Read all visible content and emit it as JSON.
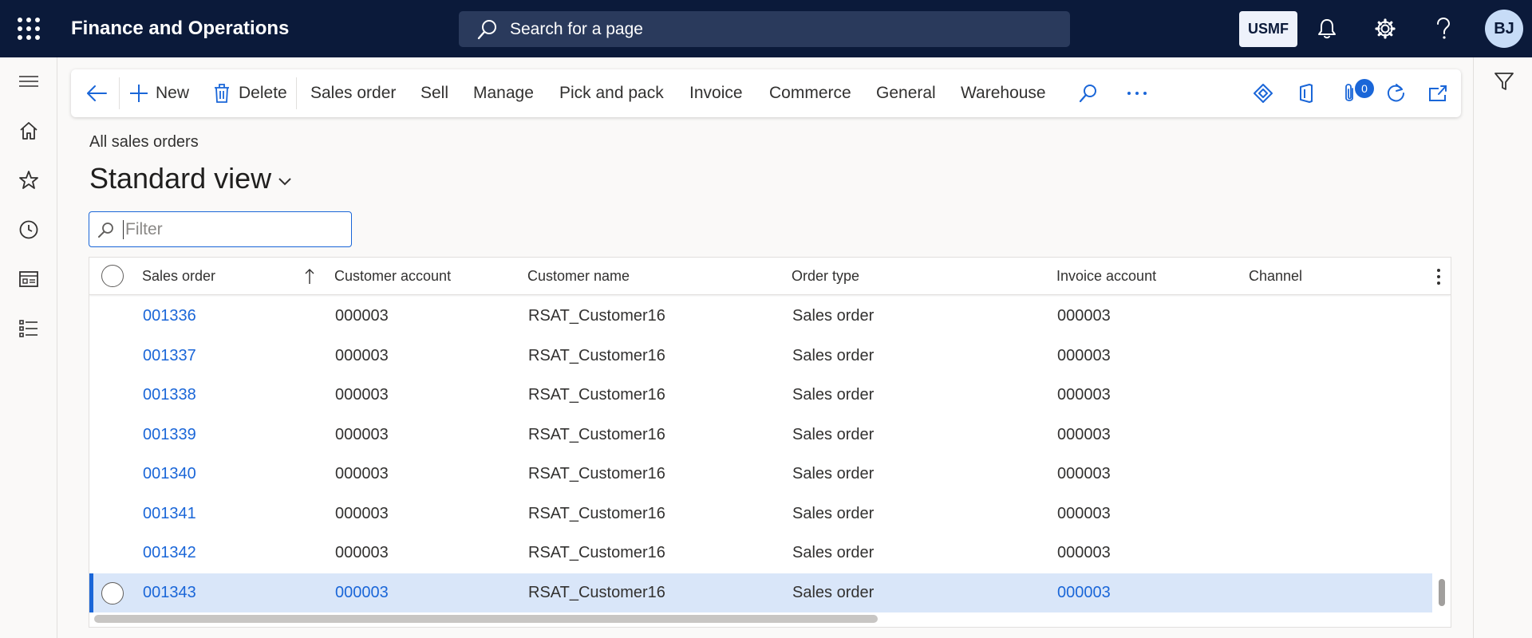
{
  "app": {
    "title": "Finance and Operations"
  },
  "search": {
    "placeholder": "Search for a page"
  },
  "header": {
    "company": "USMF",
    "avatar_initials": "BJ"
  },
  "action_pane": {
    "new_label": "New",
    "delete_label": "Delete",
    "tabs": [
      "Sales order",
      "Sell",
      "Manage",
      "Pick and pack",
      "Invoice",
      "Commerce",
      "General",
      "Warehouse"
    ],
    "attachments_count": "0"
  },
  "page": {
    "breadcrumb": "All sales orders",
    "view_title": "Standard view"
  },
  "filter": {
    "placeholder": "Filter"
  },
  "grid": {
    "columns": [
      "Sales order",
      "Customer account",
      "Customer name",
      "Order type",
      "Invoice account",
      "Channel"
    ],
    "rows": [
      {
        "sales_order": "001336",
        "customer_account": "000003",
        "customer_name": "RSAT_Customer16",
        "order_type": "Sales order",
        "invoice_account": "000003",
        "channel": ""
      },
      {
        "sales_order": "001337",
        "customer_account": "000003",
        "customer_name": "RSAT_Customer16",
        "order_type": "Sales order",
        "invoice_account": "000003",
        "channel": ""
      },
      {
        "sales_order": "001338",
        "customer_account": "000003",
        "customer_name": "RSAT_Customer16",
        "order_type": "Sales order",
        "invoice_account": "000003",
        "channel": ""
      },
      {
        "sales_order": "001339",
        "customer_account": "000003",
        "customer_name": "RSAT_Customer16",
        "order_type": "Sales order",
        "invoice_account": "000003",
        "channel": ""
      },
      {
        "sales_order": "001340",
        "customer_account": "000003",
        "customer_name": "RSAT_Customer16",
        "order_type": "Sales order",
        "invoice_account": "000003",
        "channel": ""
      },
      {
        "sales_order": "001341",
        "customer_account": "000003",
        "customer_name": "RSAT_Customer16",
        "order_type": "Sales order",
        "invoice_account": "000003",
        "channel": ""
      },
      {
        "sales_order": "001342",
        "customer_account": "000003",
        "customer_name": "RSAT_Customer16",
        "order_type": "Sales order",
        "invoice_account": "000003",
        "channel": ""
      },
      {
        "sales_order": "001343",
        "customer_account": "000003",
        "customer_name": "RSAT_Customer16",
        "order_type": "Sales order",
        "invoice_account": "000003",
        "channel": ""
      }
    ],
    "selected_row": 7
  },
  "colors": {
    "topbar": "#0b1a3a",
    "accent": "#1a66d8",
    "selected_row": "#d9e6f9"
  }
}
